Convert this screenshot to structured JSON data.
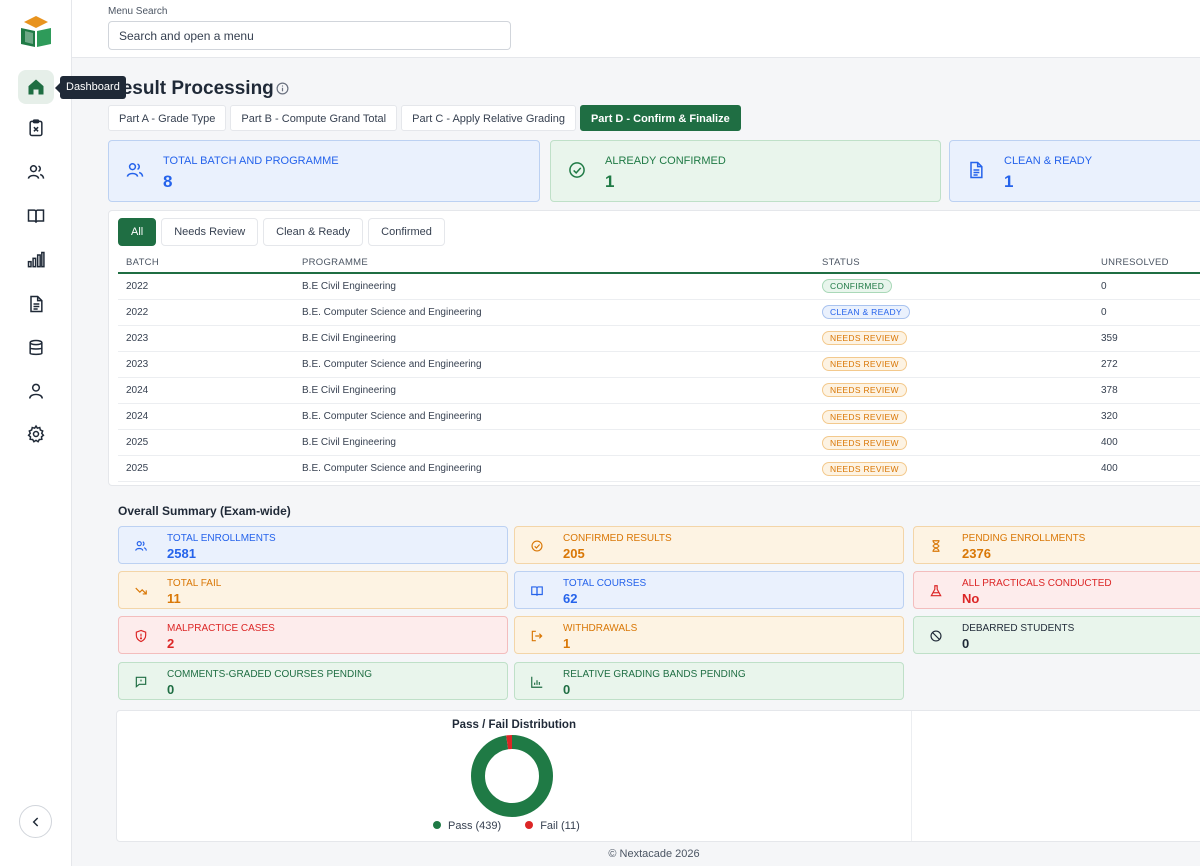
{
  "sidebar": {
    "tooltip": "Dashboard",
    "items": [
      {
        "name": "home-icon"
      },
      {
        "name": "clipboard-icon"
      },
      {
        "name": "users-icon"
      },
      {
        "name": "book-icon"
      },
      {
        "name": "bar-chart-icon"
      },
      {
        "name": "document-icon"
      },
      {
        "name": "database-icon"
      },
      {
        "name": "user-icon"
      },
      {
        "name": "gear-icon"
      }
    ]
  },
  "search": {
    "label": "Menu Search",
    "placeholder": "Search and open a menu"
  },
  "page": {
    "title": "Result Processing"
  },
  "tabs": [
    "Part A - Grade Type",
    "Part B - Compute Grand Total",
    "Part C - Apply Relative Grading",
    "Part D - Confirm & Finalize"
  ],
  "stats": [
    {
      "label": "TOTAL BATCH AND PROGRAMME",
      "value": "8"
    },
    {
      "label": "ALREADY CONFIRMED",
      "value": "1"
    },
    {
      "label": "CLEAN & READY",
      "value": "1"
    }
  ],
  "filters": [
    "All",
    "Needs Review",
    "Clean & Ready",
    "Confirmed"
  ],
  "table": {
    "headers": [
      "BATCH",
      "PROGRAMME",
      "STATUS",
      "UNRESOLVED"
    ],
    "rows": [
      {
        "batch": "2022",
        "programme": "B.E Civil Engineering",
        "status": "CONFIRMED",
        "unresolved": "0"
      },
      {
        "batch": "2022",
        "programme": "B.E. Computer Science and Engineering",
        "status": "CLEAN & READY",
        "unresolved": "0"
      },
      {
        "batch": "2023",
        "programme": "B.E Civil Engineering",
        "status": "NEEDS REVIEW",
        "unresolved": "359"
      },
      {
        "batch": "2023",
        "programme": "B.E. Computer Science and Engineering",
        "status": "NEEDS REVIEW",
        "unresolved": "272"
      },
      {
        "batch": "2024",
        "programme": "B.E Civil Engineering",
        "status": "NEEDS REVIEW",
        "unresolved": "378"
      },
      {
        "batch": "2024",
        "programme": "B.E. Computer Science and Engineering",
        "status": "NEEDS REVIEW",
        "unresolved": "320"
      },
      {
        "batch": "2025",
        "programme": "B.E Civil Engineering",
        "status": "NEEDS REVIEW",
        "unresolved": "400"
      },
      {
        "batch": "2025",
        "programme": "B.E. Computer Science and Engineering",
        "status": "NEEDS REVIEW",
        "unresolved": "400"
      }
    ]
  },
  "summary": {
    "title": "Overall Summary (Exam-wide)",
    "cards": [
      {
        "label": "TOTAL ENROLLMENTS",
        "value": "2581"
      },
      {
        "label": "CONFIRMED RESULTS",
        "value": "205"
      },
      {
        "label": "PENDING ENROLLMENTS",
        "value": "2376"
      },
      {
        "label": "TOTAL FAIL",
        "value": "11"
      },
      {
        "label": "TOTAL COURSES",
        "value": "62"
      },
      {
        "label": "ALL PRACTICALS CONDUCTED",
        "value": "No"
      },
      {
        "label": "MALPRACTICE CASES",
        "value": "2"
      },
      {
        "label": "WITHDRAWALS",
        "value": "1"
      },
      {
        "label": "DEBARRED STUDENTS",
        "value": "0"
      },
      {
        "label": "COMMENTS-GRADED COURSES PENDING",
        "value": "0"
      },
      {
        "label": "RELATIVE GRADING BANDS PENDING",
        "value": "0"
      }
    ]
  },
  "chart_data": {
    "type": "pie",
    "title": "Pass / Fail Distribution",
    "categories": [
      "Pass",
      "Fail"
    ],
    "values": [
      439,
      11
    ],
    "legend": [
      "Pass (439)",
      "Fail (11)"
    ],
    "colors": [
      "#1f7a45",
      "#dc2626"
    ],
    "legend_position": "bottom"
  },
  "footer": "© Nextacade 2026"
}
